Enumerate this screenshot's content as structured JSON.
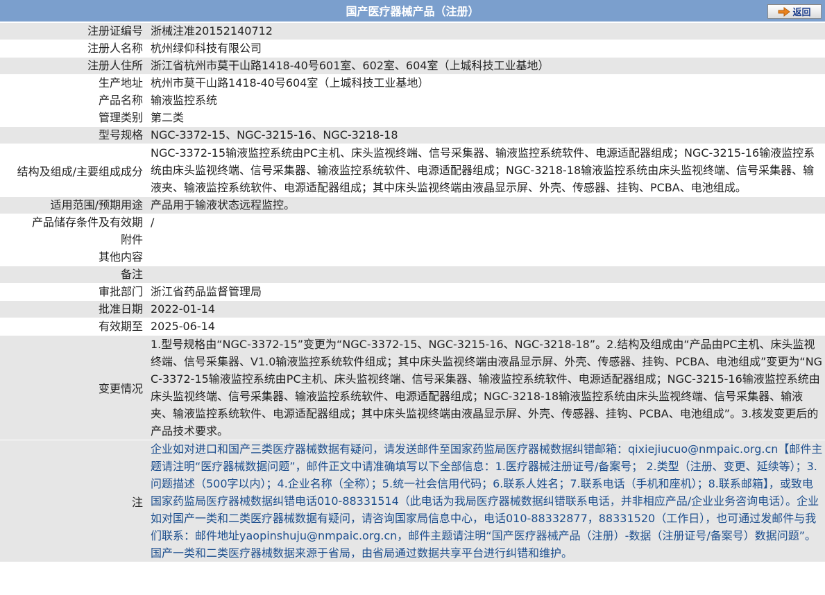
{
  "header": {
    "title": "国产医疗器械产品（注册）",
    "back_label": "返回",
    "colors": {
      "bar": "#7b9fcd",
      "shade": "#e6e6e6",
      "note_text": "#1d4f8e"
    }
  },
  "rows": [
    {
      "label": "注册证编号",
      "value": "浙械注准20152140712"
    },
    {
      "label": "注册人名称",
      "value": "杭州绿仰科技有限公司"
    },
    {
      "label": "注册人住所",
      "value": "浙江省杭州市莫干山路1418-40号601室、602室、604室（上城科技工业基地）"
    },
    {
      "label": "生产地址",
      "value": "杭州市莫干山路1418-40号604室（上城科技工业基地）"
    },
    {
      "label": "产品名称",
      "value": "输液监控系统"
    },
    {
      "label": "管理类别",
      "value": "第二类"
    },
    {
      "label": "型号规格",
      "value": "NGC-3372-15、NGC-3215-16、NGC-3218-18"
    },
    {
      "label": "结构及组成/主要组成成分",
      "value": "NGC-3372-15输液监控系统由PC主机、床头监视终端、信号采集器、输液监控系统软件、电源适配器组成；NGC-3215-16输液监控系统由床头监视终端、信号采集器、输液监控系统软件、电源适配器组成；NGC-3218-18输液监控系统由床头监视终端、信号采集器、输液夹、输液监控系统软件、电源适配器组成；其中床头监视终端由液晶显示屏、外壳、传感器、挂钩、PCBA、电池组成。"
    },
    {
      "label": "适用范围/预期用途",
      "value": "产品用于输液状态远程监控。"
    },
    {
      "label": "产品储存条件及有效期",
      "value": "/"
    },
    {
      "label": "附件",
      "value": ""
    },
    {
      "label": "其他内容",
      "value": ""
    },
    {
      "label": "备注",
      "value": ""
    },
    {
      "label": "审批部门",
      "value": "浙江省药品监督管理局"
    },
    {
      "label": "批准日期",
      "value": "2022-01-14"
    },
    {
      "label": "有效期至",
      "value": "2025-06-14"
    },
    {
      "label": "变更情况",
      "value": "1.型号规格由“NGC-3372-15”变更为“NGC-3372-15、NGC-3215-16、NGC-3218-18”。2.结构及组成由“产品由PC主机、床头监视终端、信号采集器、V1.0输液监控系统软件组成；其中床头监视终端由液晶显示屏、外壳、传感器、挂钩、PCBA、电池组成”变更为“NGC-3372-15输液监控系统由PC主机、床头监视终端、信号采集器、输液监控系统软件、电源适配器组成；NGC-3215-16输液监控系统由床头监视终端、信号采集器、输液监控系统软件、电源适配器组成；NGC-3218-18输液监控系统由床头监视终端、信号采集器、输液夹、输液监控系统软件、电源适配器组成；其中床头监视终端由液晶显示屏、外壳、传感器、挂钩、PCBA、电池组成”。3.核发变更后的产品技术要求。"
    },
    {
      "label": "注",
      "value": "企业如对进口和国产三类医疗器械数据有疑问，请发送邮件至国家药监局医疗器械数据纠错邮箱：qixiejiucuo@nmpaic.org.cn【邮件主题请注明“医疗器械数据问题”，邮件正文中请准确填写以下全部信息：1.医疗器械注册证号/备案号； 2.类型（注册、变更、延续等）；3.问题描述（500字以内）；4.企业名称（全称）；5.统一社会信用代码；6.联系人姓名；7.联系电话（手机和座机）；8.联系邮箱】，或致电国家药监局医疗器械数据纠错电话010-88331514（此电话为我局医疗器械数据纠错联系电话，并非相应产品/企业业务咨询电话）。企业如对国产一类和二类医疗器械数据有疑问，请咨询国家局信息中心，电话010-88332877，88331520（工作日），也可通过发邮件与我们联系：邮件地址yaopinshuju@nmpaic.org.cn，邮件主题请注明“国产医疗器械产品（注册）-数据（注册证号/备案号）数据问题”。国产一类和二类医疗器械数据来源于省局，由省局通过数据共享平台进行纠错和维护。"
    }
  ]
}
